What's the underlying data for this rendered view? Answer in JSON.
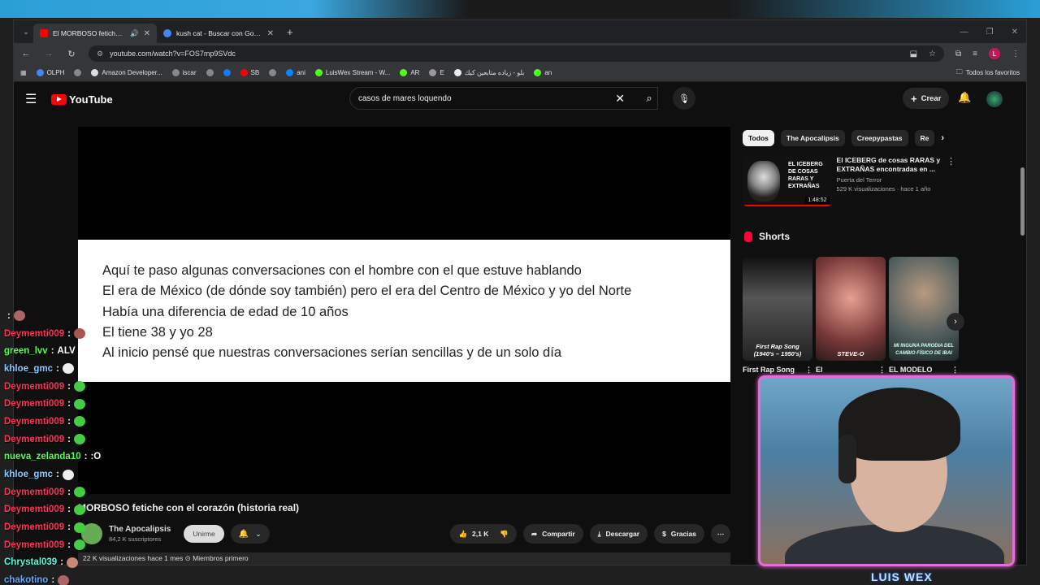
{
  "browser": {
    "tabs": [
      {
        "title": "El MORBOSO fetiche con el c",
        "fav_color": "#ff0000",
        "active": true
      },
      {
        "title": "kush cat - Buscar con Google",
        "fav_color": "#4285f4",
        "active": false
      }
    ],
    "url": "youtube.com/watch?v=FOS7mp9SVdc",
    "bookmarks": [
      {
        "label": "OLPH",
        "color": "#4285f4"
      },
      {
        "label": "",
        "color": "#888"
      },
      {
        "label": "Amazon Developer...",
        "color": "#ddd"
      },
      {
        "label": "iscar",
        "color": "#888"
      },
      {
        "label": "",
        "color": "#888"
      },
      {
        "label": "",
        "color": "#1877f2"
      },
      {
        "label": "SB",
        "color": "#ff0000"
      },
      {
        "label": "",
        "color": "#888"
      },
      {
        "label": "ani",
        "color": "#0a84ff"
      },
      {
        "label": "LuisWex Stream - W...",
        "color": "#53fc18"
      },
      {
        "label": "AR",
        "color": "#53fc18"
      },
      {
        "label": "E",
        "color": "#999"
      },
      {
        "label": "بلو - زياده متابعين كيك",
        "color": "#eee"
      },
      {
        "label": "an",
        "color": "#53fc18"
      }
    ],
    "bookmarks_right": "Todos los favoritos",
    "profile_letter": "L"
  },
  "youtube": {
    "logo": "YouTube",
    "search_value": "casos de mares loquendo",
    "create_label": "Crear",
    "slide_lines": [
      "Aquí te paso algunas conversaciones con el hombre con el que estuve hablando",
      "El era de México (de dónde soy también) pero el era del Centro de México y yo del Norte",
      "Había una diferencia de edad de 10 años",
      "El tiene 38 y yo 28",
      "Al inicio pensé que nuestras conversaciones serían sencillas y de un solo día"
    ],
    "video_title": "MORBOSO fetiche con el corazón (historia real)",
    "channel_name": "The Apocalipsis",
    "subscribers": "84,2 K suscriptores",
    "join_label": "Unirme",
    "likes": "2,1 K",
    "share_label": "Compartir",
    "download_label": "Descargar",
    "thanks_label": "Gracias",
    "desc_line": "22 K visualizaciones  hace 1 mes  ⊙ Miembros primero",
    "chips": [
      "Todos",
      "The Apocalipsis",
      "Creepypastas",
      "Re"
    ],
    "rec": {
      "title": "El ICEBERG de cosas RARAS y EXTRAÑAS encontradas en ...",
      "channel": "Puerta del Terror",
      "stats": "529 K visualizaciones · hace 1 año",
      "duration": "1:48:52",
      "thumb_text": "EL ICEBERG DE COSAS RARAS Y EXTRAÑAS"
    },
    "shorts_label": "Shorts",
    "shorts": [
      {
        "caption": "First Rap Song (1940's – 1950's)",
        "title": "First Rap Song",
        "color": "#3c3c3c"
      },
      {
        "caption": "STEVE-O",
        "title": "El",
        "color": "#8a4a4a"
      },
      {
        "caption": "MI INGUNA PARODIA DEL CAMBIO FÍSICO DE IBAI",
        "title": "EL MODELO",
        "color": "#4d5a5a"
      }
    ]
  },
  "chat": [
    {
      "user": "",
      "color": "#6cf",
      "msg": "",
      "emote": "#a66"
    },
    {
      "user": "Deymemti009",
      "color": "#ff3355",
      "msg": "",
      "emote": "#a55"
    },
    {
      "user": "green_lvv",
      "color": "#5f5",
      "msg": "ALV",
      "emote": ""
    },
    {
      "user": "khloe_gmc",
      "color": "#8cf",
      "msg": "",
      "emote": "#eee"
    },
    {
      "user": "Deymemti009",
      "color": "#ff3355",
      "msg": "",
      "emote": "#4c4"
    },
    {
      "user": "Deymemti009",
      "color": "#ff3355",
      "msg": "",
      "emote": "#4c4"
    },
    {
      "user": "Deymemti009",
      "color": "#ff3355",
      "msg": "",
      "emote": "#4c4"
    },
    {
      "user": "Deymemti009",
      "color": "#ff3355",
      "msg": "",
      "emote": "#4c4"
    },
    {
      "user": "nueva_zelanda10",
      "color": "#5f5",
      "msg": ":O",
      "emote": ""
    },
    {
      "user": "khloe_gmc",
      "color": "#8cf",
      "msg": "",
      "emote": "#eee"
    },
    {
      "user": "Deymemti009",
      "color": "#ff3355",
      "msg": "",
      "emote": "#4c4"
    },
    {
      "user": "Deymemti009",
      "color": "#ff3355",
      "msg": "",
      "emote": "#4c4"
    },
    {
      "user": "Deymemti009",
      "color": "#ff3355",
      "msg": "",
      "emote": "#4c4"
    },
    {
      "user": "Deymemti009",
      "color": "#ff3355",
      "msg": "",
      "emote": "#4c4"
    },
    {
      "user": "Chrystal039",
      "color": "#5fd",
      "msg": "",
      "emote": "#c87"
    },
    {
      "user": "chakotino",
      "color": "#6af",
      "msg": "",
      "emote": "#a66"
    }
  ],
  "webcam_label": "LUIS WEX"
}
